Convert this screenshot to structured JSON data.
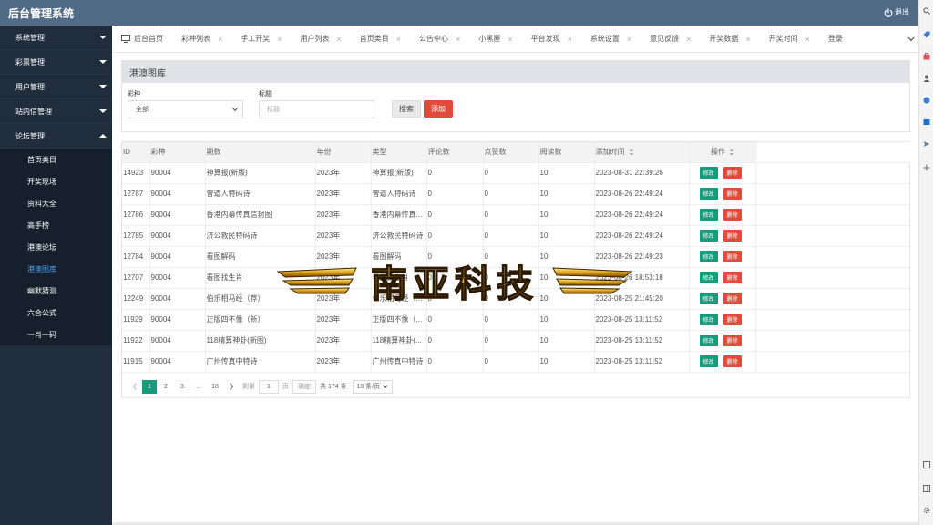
{
  "header": {
    "title": "后台管理系统",
    "logout_label": "退出"
  },
  "sidebar": {
    "groups": [
      {
        "label": "系统管理"
      },
      {
        "label": "彩票管理"
      },
      {
        "label": "用户管理"
      },
      {
        "label": "站内信管理"
      },
      {
        "label": "论坛管理"
      }
    ],
    "subitems": [
      {
        "label": "首页类目"
      },
      {
        "label": "开奖现场"
      },
      {
        "label": "资料大全"
      },
      {
        "label": "高手榜"
      },
      {
        "label": "港澳论坛"
      },
      {
        "label": "港澳图库",
        "active": true
      },
      {
        "label": "幽默猜测"
      },
      {
        "label": "六合公式"
      },
      {
        "label": "一肖一码"
      }
    ]
  },
  "tabs": [
    {
      "label": "后台首页"
    },
    {
      "label": "彩种列表"
    },
    {
      "label": "手工开奖"
    },
    {
      "label": "用户列表"
    },
    {
      "label": "首页类目"
    },
    {
      "label": "公告中心"
    },
    {
      "label": "小黑屋"
    },
    {
      "label": "平台发现"
    },
    {
      "label": "系统设置"
    },
    {
      "label": "意见反馈"
    },
    {
      "label": "开奖数据"
    },
    {
      "label": "开奖时间"
    },
    {
      "label": "登录"
    }
  ],
  "panel": {
    "title": "港澳图库",
    "lottery_label": "彩种",
    "lottery_value": "全部",
    "title_label": "标题",
    "title_placeholder": "标题",
    "search_label": "搜索",
    "add_label": "添加"
  },
  "table": {
    "columns": [
      "ID",
      "彩种",
      "期数",
      "年份",
      "类型",
      "评论数",
      "点赞数",
      "阅读数",
      "添加时间",
      "操作"
    ],
    "edit_label": "修改",
    "delete_label": "删除",
    "rows": [
      {
        "id": "14923",
        "lottery": "90004",
        "issue": "神算报(新版)",
        "year": "2023年",
        "type": "神算报(新版)",
        "comments": "0",
        "likes": "0",
        "reads": "10",
        "time": "2023-08-31 22:39:26"
      },
      {
        "id": "12787",
        "lottery": "90004",
        "issue": "曾道人特码诗",
        "year": "2023年",
        "type": "曾道人特码诗",
        "comments": "0",
        "likes": "0",
        "reads": "10",
        "time": "2023-08-26 22:49:24"
      },
      {
        "id": "12786",
        "lottery": "90004",
        "issue": "香港内幕传真信封图",
        "year": "2023年",
        "type": "香港内幕传真...",
        "comments": "0",
        "likes": "0",
        "reads": "10",
        "time": "2023-08-26 22:49:24"
      },
      {
        "id": "12785",
        "lottery": "90004",
        "issue": "济公救民特码诗",
        "year": "2023年",
        "type": "济公救民特码诗",
        "comments": "0",
        "likes": "0",
        "reads": "10",
        "time": "2023-08-26 22:49:24"
      },
      {
        "id": "12784",
        "lottery": "90004",
        "issue": "看图解码",
        "year": "2023年",
        "type": "看图解码",
        "comments": "0",
        "likes": "0",
        "reads": "10",
        "time": "2023-08-26 22:49:23"
      },
      {
        "id": "12707",
        "lottery": "90004",
        "issue": "看图找生肖",
        "year": "2023年",
        "type": "看图找生肖",
        "comments": "0",
        "likes": "0",
        "reads": "10",
        "time": "2023-08-26 18:53:18"
      },
      {
        "id": "12249",
        "lottery": "90004",
        "issue": "伯乐相马经（荐）",
        "year": "2023年",
        "type": "伯乐相马经（...",
        "comments": "0",
        "likes": "0",
        "reads": "10",
        "time": "2023-08-25 21:45:20"
      },
      {
        "id": "11929",
        "lottery": "90004",
        "issue": "正版四不像（新）",
        "year": "2023年",
        "type": "正版四不像（...",
        "comments": "0",
        "likes": "0",
        "reads": "10",
        "time": "2023-08-25 13:11:52"
      },
      {
        "id": "11922",
        "lottery": "90004",
        "issue": "118精算神卦(新图)",
        "year": "2023年",
        "type": "118精算神卦(...",
        "comments": "0",
        "likes": "0",
        "reads": "10",
        "time": "2023-08-25 13:11:52"
      },
      {
        "id": "11915",
        "lottery": "90004",
        "issue": "广州传真中特诗",
        "year": "2023年",
        "type": "广州传真中特诗",
        "comments": "0",
        "likes": "0",
        "reads": "10",
        "time": "2023-08-25 13:11:52"
      }
    ]
  },
  "pager": {
    "pages": [
      "1",
      "2",
      "3",
      "...",
      "18"
    ],
    "current": "1",
    "goto_label": "到第",
    "goto_value": "1",
    "page_unit": "页",
    "confirm_label": "确定",
    "total_label": "共 174 条",
    "page_size": "10 条/页"
  },
  "watermark": {
    "text": "南亚科技"
  },
  "colors": {
    "header": "#516b87",
    "sidebar": "#1f2d3d",
    "primary": "#169c7a",
    "danger": "#e14b3b"
  }
}
